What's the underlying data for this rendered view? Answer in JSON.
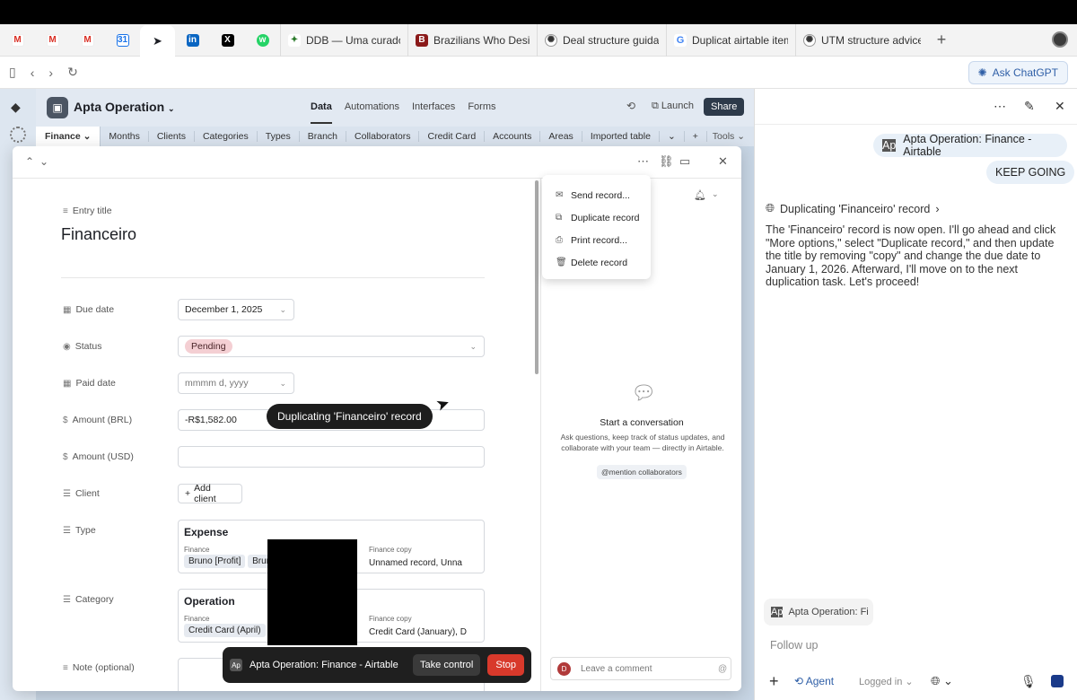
{
  "browser": {
    "tabs": [
      {
        "icon": "gmail-icon",
        "label": ""
      },
      {
        "icon": "gmail-icon",
        "label": ""
      },
      {
        "icon": "gmail-icon",
        "label": ""
      },
      {
        "icon": "calendar-icon",
        "label": ""
      },
      {
        "icon": "cursor-arrow-icon",
        "label": ""
      },
      {
        "icon": "linkedin-icon",
        "label": ""
      },
      {
        "icon": "x-icon",
        "label": ""
      },
      {
        "icon": "whatsapp-icon",
        "label": ""
      },
      {
        "icon": "ddb-icon",
        "label": "DDB — Uma curadori"
      },
      {
        "icon": "brazilians-icon",
        "label": "Brazilians Who Desig"
      },
      {
        "icon": "openai-icon",
        "label": "Deal structure guidan"
      },
      {
        "icon": "google-icon",
        "label": "Duplicat airtable item"
      },
      {
        "icon": "openai-icon",
        "label": "UTM structure advice"
      }
    ],
    "ask_chatgpt_label": "Ask ChatGPT"
  },
  "airtable": {
    "base_name": "Apta Operation",
    "nav": [
      "Data",
      "Automations",
      "Interfaces",
      "Forms"
    ],
    "launch_label": "Launch",
    "share_label": "Share",
    "tables": [
      "Finance",
      "Months",
      "Clients",
      "Categories",
      "Types",
      "Branch",
      "Collaborators",
      "Credit Card",
      "Accounts",
      "Areas",
      "Imported table"
    ],
    "tools_label": "Tools",
    "record": {
      "entry_title_label": "Entry title",
      "title": "Financeiro",
      "fields": {
        "due_date_label": "Due date",
        "due_date_value": "December 1, 2025",
        "status_label": "Status",
        "status_value": "Pending",
        "paid_date_label": "Paid date",
        "paid_date_placeholder": "mmmm d, yyyy",
        "amount_brl_label": "Amount (BRL)",
        "amount_brl_value": "-R$1,582.00",
        "amount_usd_label": "Amount (USD)",
        "amount_usd_value": "",
        "client_label": "Client",
        "add_client_label": "Add client",
        "type_label": "Type",
        "type_card": {
          "heading": "Expense",
          "left_label": "Finance",
          "left_chips": [
            "Bruno [Profit]",
            "Brun"
          ],
          "right_label": "Finance copy",
          "right_value": "Unnamed record, Unna"
        },
        "category_label": "Category",
        "category_card": {
          "heading": "Operation",
          "left_label": "Finance",
          "left_chips": [
            "Credit Card (April)"
          ],
          "right_label": "Finance copy",
          "right_value": "Credit Card (January), D"
        },
        "note_label": "Note (optional)"
      }
    },
    "menu": [
      "Send record...",
      "Duplicate record",
      "Print record...",
      "Delete record"
    ],
    "comments": {
      "title": "Start a conversation",
      "body": "Ask questions, keep track of status updates, and collaborate with your team — directly in Airtable.",
      "mention_label": "@mention collaborators",
      "placeholder": "Leave a comment",
      "avatar_letter": "D"
    },
    "tooltip": "Duplicating 'Financeiro' record",
    "control_bar": {
      "source": "Apta Operation: Finance - Airtable",
      "take_control": "Take control",
      "stop": "Stop"
    }
  },
  "chat": {
    "context_bubble": "Apta Operation: Finance - Airtable",
    "user_message": "KEEP GOING",
    "step_title": "Duplicating 'Financeiro' record",
    "assistant_message": "The 'Financeiro' record is now open. I'll go ahead and click \"More options,\" select \"Duplicate record,\" and then update the title by removing \"copy\" and change the due date to January 1, 2026. Afterward, I'll move on to the next duplication task. Let's proceed!",
    "context_chip": "Apta Operation: Fi",
    "followup_placeholder": "Follow up",
    "agent_label": "Agent",
    "logged_in_label": "Logged in"
  }
}
